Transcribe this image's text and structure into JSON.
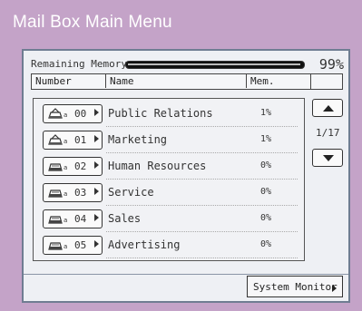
{
  "window": {
    "title": "Mail Box Main Menu"
  },
  "memory": {
    "label": "Remaining Memory:",
    "value_text": "99%",
    "fraction": 0.99
  },
  "table": {
    "columns": [
      "Number",
      "Name",
      "Mem."
    ],
    "rows": [
      {
        "number": "00",
        "name": "Public Relations",
        "mem": "1%"
      },
      {
        "number": "01",
        "name": "Marketing",
        "mem": "1%"
      },
      {
        "number": "02",
        "name": "Human Resources",
        "mem": "0%"
      },
      {
        "number": "03",
        "name": "Service",
        "mem": "0%"
      },
      {
        "number": "04",
        "name": "Sales",
        "mem": "0%"
      },
      {
        "number": "05",
        "name": "Advertising",
        "mem": "0%"
      }
    ]
  },
  "pagination": {
    "text": "1/17"
  },
  "footer": {
    "system_monitor_label": "System Monitor"
  },
  "icons": {
    "mailbox": "mailbox-tray-icon",
    "scroll_up": "triangle-up-icon",
    "scroll_down": "triangle-down-icon",
    "row_arrow": "triangle-right-icon"
  }
}
